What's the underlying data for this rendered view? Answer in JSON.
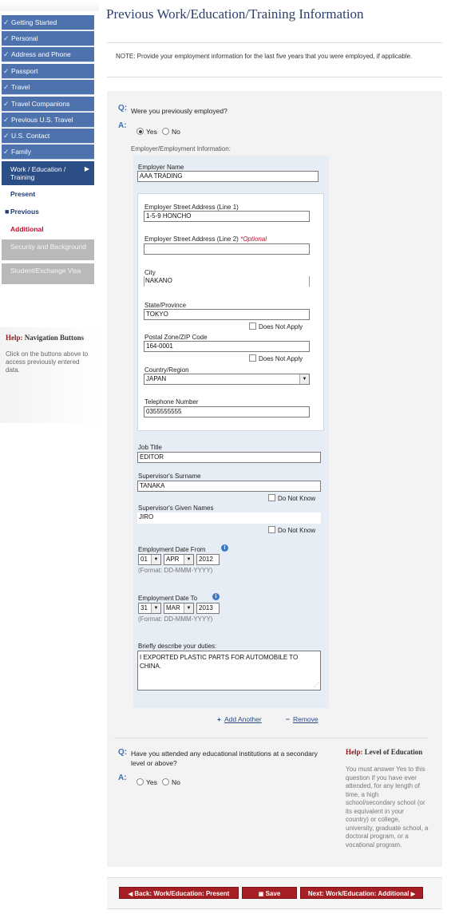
{
  "sidebar": {
    "items": [
      {
        "label": "Getting Started"
      },
      {
        "label": "Personal"
      },
      {
        "label": "Address and Phone"
      },
      {
        "label": "Passport"
      },
      {
        "label": "Travel"
      },
      {
        "label": "Travel Companions"
      },
      {
        "label": "Previous U.S. Travel"
      },
      {
        "label": "U.S. Contact"
      },
      {
        "label": "Family"
      }
    ],
    "active_section": "Work / Education / Training",
    "sub_items": {
      "present": "Present",
      "previous": "Previous",
      "additional": "Additional"
    },
    "disabled_items": [
      {
        "label": "Security and Background"
      },
      {
        "label": "Student/Exchange Visa"
      }
    ],
    "help": {
      "prefix": "Help:",
      "title": "Navigation Buttons",
      "text": "Click on the buttons above to access previously entered data."
    }
  },
  "page": {
    "title": "Previous Work/Education/Training Information",
    "note": "NOTE: Provide your employment information for the last five years that you were employed, if applicable."
  },
  "employment_question": {
    "q_marker": "Q:",
    "a_marker": "A:",
    "question": "Were you previously employed?",
    "yes_label": "Yes",
    "no_label": "No",
    "selected": "Yes"
  },
  "employer": {
    "section_label": "Employer/Employment Information:",
    "name_label": "Employer Name",
    "name": "AAA TRADING",
    "street1_label": "Employer Street Address (Line 1)",
    "street1": "1-5-9 HONCHO",
    "street2_label": "Employer Street Address (Line 2)",
    "street2_optional": "*Optional",
    "street2": "",
    "city_label": "City",
    "city": "NAKANO",
    "state_label": "State/Province",
    "state": "TOKYO",
    "state_dna": "Does Not Apply",
    "postal_label": "Postal Zone/ZIP Code",
    "postal": "164-0001",
    "postal_dna": "Does Not Apply",
    "country_label": "Country/Region",
    "country": "JAPAN",
    "phone_label": "Telephone Number",
    "phone": "0355555555",
    "job_title_label": "Job Title",
    "job_title": "EDITOR",
    "sup_surname_label": "Supervisor's Surname",
    "sup_surname": "TANAKA",
    "sup_surname_dnk": "Do Not Know",
    "sup_given_label": "Supervisor's Given Names",
    "sup_given": "JIRO",
    "sup_given_dnk": "Do Not Know",
    "date_from_label": "Employment Date From",
    "date_from": {
      "day": "01",
      "month": "APR",
      "year": "2012"
    },
    "date_to_label": "Employment Date To",
    "date_to": {
      "day": "31",
      "month": "MAR",
      "year": "2013"
    },
    "date_format": "(Format: DD-MMM-YYYY)",
    "duties_label": "Briefly describe your duties:",
    "duties": "I EXPORTED PLASTIC PARTS FOR AUTOMOBILE TO CHINA."
  },
  "actions": {
    "add_another": "Add Another",
    "remove": "Remove"
  },
  "education_question": {
    "q_marker": "Q:",
    "a_marker": "A:",
    "question": "Have you attended any educational institutions at a secondary level or above?",
    "yes_label": "Yes",
    "no_label": "No"
  },
  "education_help": {
    "prefix": "Help:",
    "title": "Level of Education",
    "text": "You must answer Yes to this question if you have ever attended, for any length of time, a high school/secondary school (or its equivalent in your country) or college, university, graduate school, a doctoral program, or a vocational program."
  },
  "bottom_nav": {
    "back": "Back: Work/Education: Present",
    "save": "Save",
    "next": "Next: Work/Education: Additional"
  },
  "colors": {
    "nav_blue": "#4d72ad",
    "nav_active": "#2c4e86",
    "accent_red": "#a61f24",
    "title_blue": "#2b3f6f"
  }
}
